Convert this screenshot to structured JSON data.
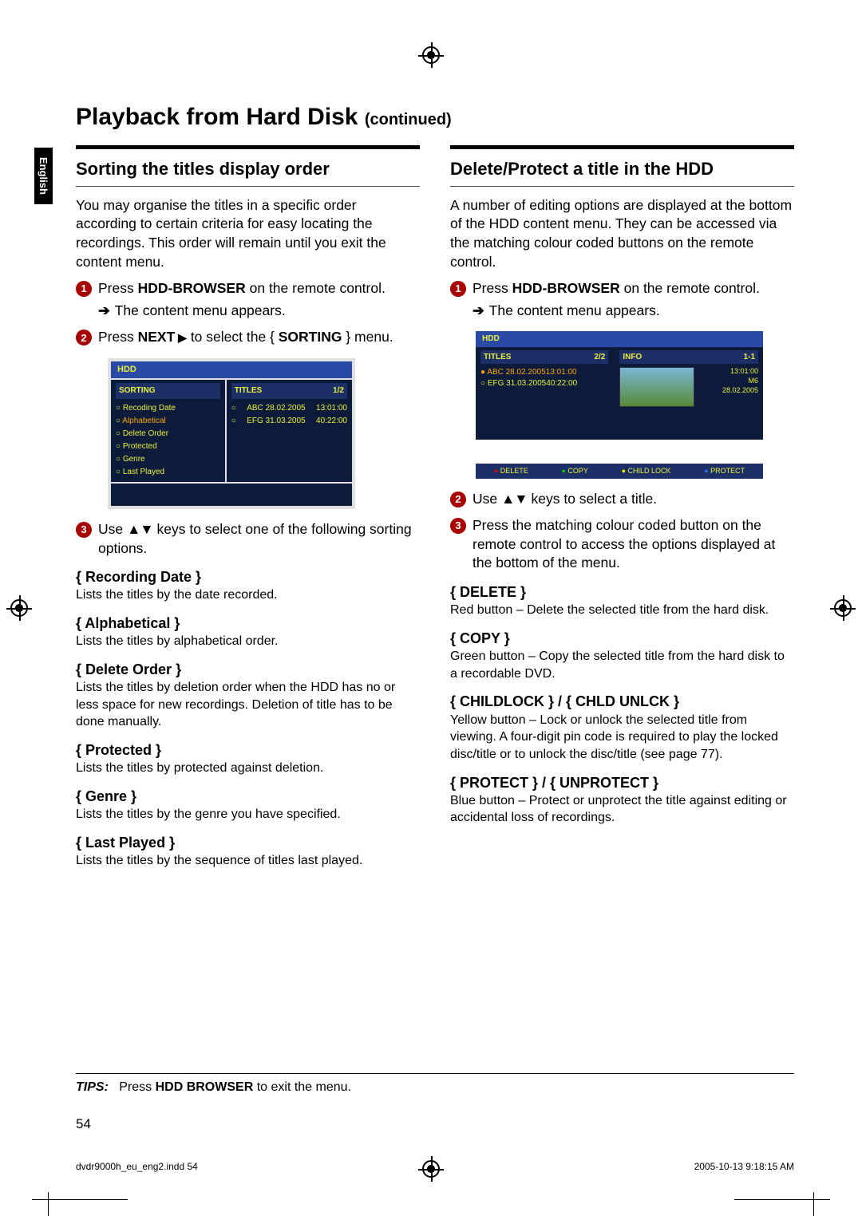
{
  "page_title_main": "Playback from Hard Disk",
  "page_title_cont": "(continued)",
  "language_tab": "English",
  "left": {
    "section": "Sorting the titles display order",
    "intro": "You may organise the titles in a specific order according to certain criteria for easy locating the recordings. This order will remain until you exit the content menu.",
    "step1_pre": "Press ",
    "step1_bold": "HDD-BROWSER",
    "step1_post": " on the remote control.",
    "step1_result": "The content menu appears.",
    "step2_pre": "Press ",
    "step2_bold": "NEXT",
    "step2_post": " to select the { ",
    "step2_bold2": "SORTING",
    "step2_post2": " } menu.",
    "shot": {
      "hdr": "HDD",
      "sort_h": "SORTING",
      "title_h": "TITLES",
      "title_ct": "1/2",
      "s1": "Recoding Date",
      "s2": "Alphabetical",
      "s3": "Delete Order",
      "s4": "Protected",
      "s5": "Genre",
      "s6": "Last Played",
      "t1a": "ABC 28.02.2005",
      "t1b": "13:01:00",
      "t2a": "EFG 31.03.2005",
      "t2b": "40:22:00"
    },
    "step3_pre": "Use ",
    "step3_post": " keys to select one of the following sorting options.",
    "opts": [
      {
        "t": "Recording Date",
        "d": "Lists the titles by the date recorded."
      },
      {
        "t": "Alphabetical",
        "d": "Lists the titles by alphabetical order."
      },
      {
        "t": "Delete Order",
        "d": "Lists the titles by deletion order when the HDD has no or less space for new recordings. Deletion of title has to be done manually."
      },
      {
        "t": "Protected",
        "d": "Lists the titles by protected against deletion."
      },
      {
        "t": "Genre",
        "d": "Lists the titles by the genre you have specified."
      },
      {
        "t": "Last Played",
        "d": "Lists the titles by the sequence of titles last played."
      }
    ]
  },
  "right": {
    "section": "Delete/Protect a title in the HDD",
    "intro": "A number of editing options are displayed at the bottom of the HDD content menu. They can be accessed via the matching colour coded buttons on the remote control.",
    "step1_pre": "Press ",
    "step1_bold": "HDD-BROWSER",
    "step1_post": " on the remote control.",
    "step1_result": "The content menu appears.",
    "shot": {
      "hdr": "HDD",
      "t_h": "TITLES",
      "t_ct": "2/2",
      "i_h": "INFO",
      "i_ct": "1-1",
      "r1a": "ABC 28.02.2005",
      "r1b": "13:01:00",
      "r2a": "EFG 31.03.2005",
      "r2b": "40:22:00",
      "info1": "13:01:00",
      "info2": "M6",
      "info3": "28.02.2005",
      "b1": "DELETE",
      "b2": "COPY",
      "b3": "CHILD LOCK",
      "b4": "PROTECT"
    },
    "step2_pre": "Use ",
    "step2_post": " keys to select a title.",
    "step3": "Press the matching colour coded button on the remote control to access the options displayed at the bottom of the menu.",
    "opts": [
      {
        "t": "DELETE",
        "d": "Red button – Delete the selected title from the hard disk."
      },
      {
        "t": "COPY",
        "d": "Green button – Copy the selected title from the hard disk to a recordable DVD."
      },
      {
        "t": "CHILDLOCK } / { CHLD UNLCK",
        "d": "Yellow button – Lock or unlock the selected title from viewing.  A four-digit pin code is required to play the locked disc/title or to unlock the disc/title (see page 77)."
      },
      {
        "t": "PROTECT } / { UNPROTECT",
        "d": "Blue button – Protect or unprotect the title against editing or accidental loss of recordings."
      }
    ]
  },
  "tips_label": "TIPS:",
  "tips_pre": "Press ",
  "tips_bold": "HDD BROWSER",
  "tips_post": " to exit the menu.",
  "page_number": "54",
  "footer_left": "dvdr9000h_eu_eng2.indd   54",
  "footer_right": "2005-10-13   9:18:15 AM"
}
